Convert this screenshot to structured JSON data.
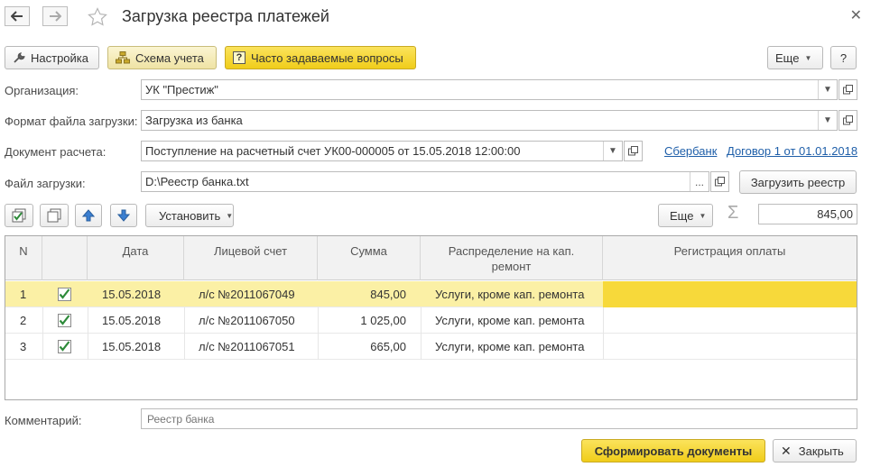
{
  "window": {
    "title": "Загрузка реестра платежей"
  },
  "toolbar": {
    "settings_label": "Настройка",
    "scheme_label": "Схема учета",
    "faq_label": "Часто задаваемые вопросы",
    "more_label": "Еще",
    "help_label": "?"
  },
  "form": {
    "org_label": "Организация:",
    "org_value": "УК \"Престиж\"",
    "format_label": "Формат файла загрузки:",
    "format_value": "Загрузка из банка",
    "doc_label": "Документ расчета:",
    "doc_value": "Поступление на расчетный счет УК00-000005 от 15.05.2018 12:00:00",
    "bank_link": "Сбербанк",
    "contract_link": "Договор 1 от 01.01.2018",
    "file_label": "Файл загрузки:",
    "file_value": "D:\\Реестр банка.txt",
    "file_btn": "...",
    "load_btn": "Загрузить реестр"
  },
  "table_toolbar": {
    "set_label": "Установить",
    "more_label": "Еще",
    "sum_symbol": "Σ",
    "total": "845,00"
  },
  "table": {
    "headers": {
      "n": "N",
      "date": "Дата",
      "account": "Лицевой счет",
      "sum": "Сумма",
      "distribution": "Распределение на кап. ремонт",
      "registration": "Регистрация оплаты"
    },
    "rows": [
      {
        "n": "1",
        "checked": true,
        "date": "15.05.2018",
        "account": "л/с №2011067049",
        "sum": "845,00",
        "distribution": "Услуги, кроме кап. ремонта",
        "registration": ""
      },
      {
        "n": "2",
        "checked": true,
        "date": "15.05.2018",
        "account": "л/с №2011067050",
        "sum": "1 025,00",
        "distribution": "Услуги, кроме кап. ремонта",
        "registration": ""
      },
      {
        "n": "3",
        "checked": true,
        "date": "15.05.2018",
        "account": "л/с №2011067051",
        "sum": "665,00",
        "distribution": "Услуги, кроме кап. ремонта",
        "registration": ""
      }
    ]
  },
  "comment": {
    "label": "Комментарий:",
    "placeholder": "Реестр банка"
  },
  "footer": {
    "create_label": "Сформировать документы",
    "close_label": "Закрыть"
  },
  "colors": {
    "accent_yellow": "#f0cd1a",
    "selected_row": "#fbf0a5",
    "link_blue": "#1f5fa9",
    "check_green": "#2e8b3a"
  }
}
